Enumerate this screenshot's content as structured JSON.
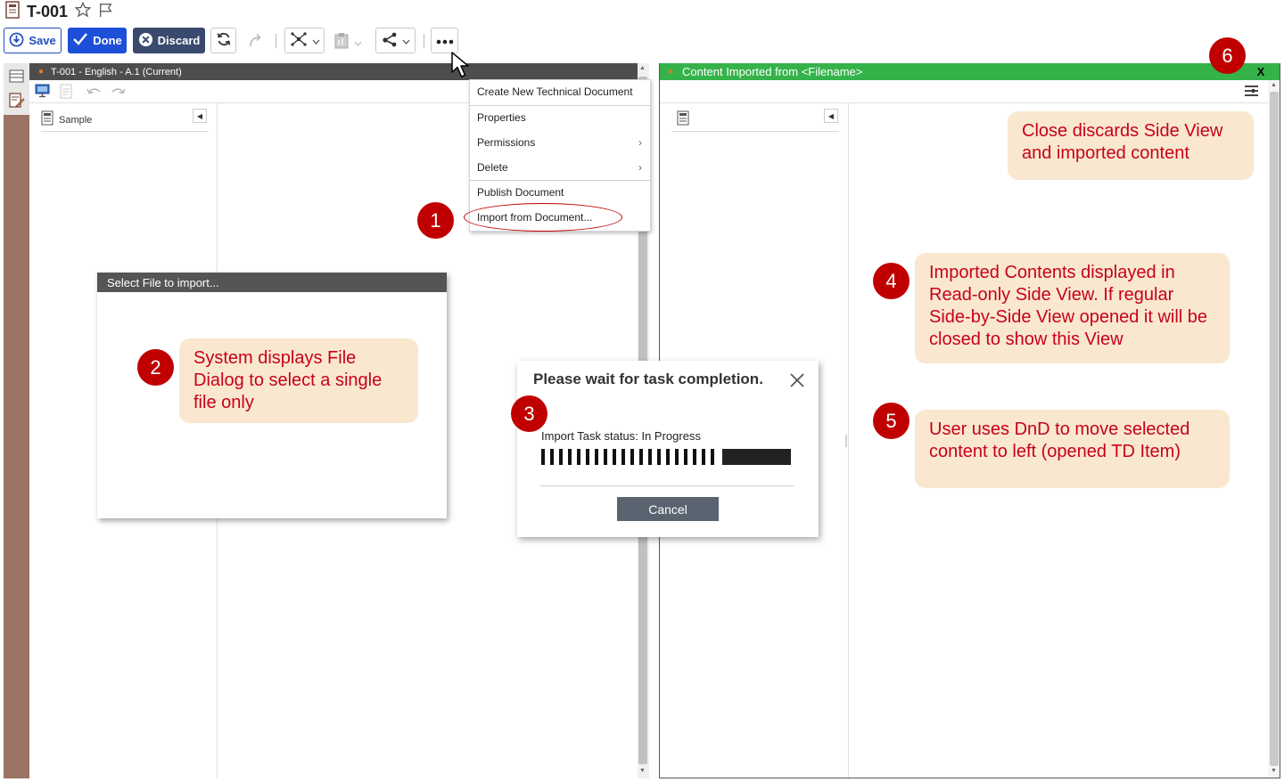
{
  "header": {
    "title": "T-001",
    "toolbar": {
      "save_label": "Save",
      "done_label": "Done",
      "discard_label": "Discard"
    }
  },
  "left_panel": {
    "tab_title": "T-001 - English - A.1 (Current)",
    "tree_root": "Sample"
  },
  "context_menu": {
    "items": [
      {
        "label": "Create New Technical Document"
      },
      {
        "label": "Properties"
      },
      {
        "label": "Permissions"
      },
      {
        "label": "Delete"
      },
      {
        "label": "Publish Document"
      },
      {
        "label": "Import from Document..."
      }
    ]
  },
  "right_panel": {
    "title": "Content Imported from <Filename>",
    "close_label": "X"
  },
  "file_dialog": {
    "title": "Select File to import..."
  },
  "wait_dialog": {
    "title": "Please wait for task completion.",
    "status": "Import Task status: In Progress",
    "cancel_label": "Cancel"
  },
  "callouts": [
    {
      "number": "1",
      "text": ""
    },
    {
      "number": "2",
      "text": "System displays File Dialog to select a single file only"
    },
    {
      "number": "3",
      "text": ""
    },
    {
      "number": "4",
      "text": "Imported Contents displayed in Read-only Side View.  If regular Side-by-Side View opened it will be closed to show this View"
    },
    {
      "number": "5",
      "text": "User uses DnD to move selected content to left (opened TD Item)"
    },
    {
      "number": "6",
      "text": "Close discards Side View and imported content"
    }
  ],
  "colors": {
    "accent_blue": "#1d4fd8",
    "discard_navy": "#394a6e",
    "side_header_green": "#35b34a",
    "annotation_red": "#c00000",
    "callout_bg": "#f9e8cf",
    "rail_brown": "#9b7465"
  }
}
